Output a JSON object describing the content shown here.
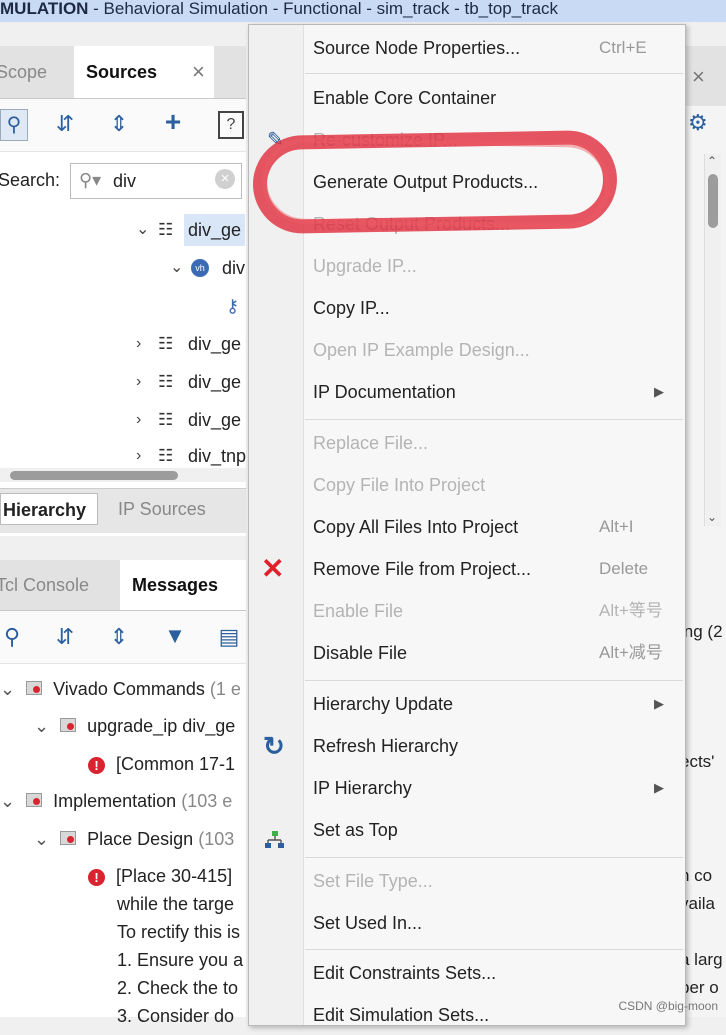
{
  "window": {
    "title_bold": "MULATION",
    "title_rest": " - Behavioral Simulation - Functional - sim_track - tb_top_track"
  },
  "sources_pane": {
    "tabs": [
      "Scope",
      "Sources"
    ],
    "close_glyph": "×",
    "search_label": "Search:",
    "search_value": "div",
    "tree": [
      {
        "label": "div_ge",
        "icon": "ip-core-icon",
        "expanded": true,
        "selected": true
      },
      {
        "label": "div",
        "icon": "vhdl-file-icon",
        "expanded": true
      },
      {
        "label": "",
        "icon": "key-icon"
      },
      {
        "label": "div_ge",
        "icon": "ip-core-icon"
      },
      {
        "label": "div_ge",
        "icon": "ip-core-icon"
      },
      {
        "label": "div_ge",
        "icon": "ip-core-icon"
      },
      {
        "label": "div_tnp",
        "icon": "ip-core-icon"
      }
    ],
    "bottom_tabs": [
      "Hierarchy",
      "IP Sources"
    ]
  },
  "messages_pane": {
    "tabs": [
      "Tcl Console",
      "Messages"
    ],
    "rows": [
      {
        "text": "Vivado Commands",
        "count": "(1 e"
      },
      {
        "text": "upgrade_ip div_ge",
        "count": ""
      },
      {
        "text": "[Common 17-1",
        "count": ""
      },
      {
        "text": "Implementation",
        "count": "(103 e"
      },
      {
        "text": "Place Design",
        "count": "(103"
      },
      {
        "text": "[Place 30-415]",
        "count": ""
      },
      {
        "text": "while the targe",
        "count": ""
      },
      {
        "text": "To rectify this is",
        "count": ""
      },
      {
        "text": "1. Ensure you a",
        "count": ""
      },
      {
        "text": "2. Check the to",
        "count": ""
      },
      {
        "text": "3. Consider do",
        "count": ""
      }
    ]
  },
  "right_fragments": [
    "ing (2",
    "ects'",
    "n co",
    "vaila",
    "a larg",
    "ber o"
  ],
  "context_menu": {
    "items": [
      {
        "label": "Source Node Properties...",
        "shortcut": "Ctrl+E",
        "enabled": true
      },
      {
        "label": "Enable Core Container",
        "enabled": true
      },
      {
        "label": "Re-customize IP...",
        "enabled": false
      },
      {
        "label": "Generate Output Products...",
        "enabled": true
      },
      {
        "label": "Reset Output Products...",
        "enabled": false
      },
      {
        "label": "Upgrade IP...",
        "enabled": false
      },
      {
        "label": "Copy IP...",
        "enabled": true
      },
      {
        "label": "Open IP Example Design...",
        "enabled": false
      },
      {
        "label": "IP Documentation",
        "enabled": true,
        "submenu": true
      },
      {
        "label": "Replace File...",
        "enabled": false
      },
      {
        "label": "Copy File Into Project",
        "enabled": false
      },
      {
        "label": "Copy All Files Into Project",
        "shortcut": "Alt+I",
        "enabled": true
      },
      {
        "label": "Remove File from Project...",
        "shortcut": "Delete",
        "enabled": true,
        "icon": "red-x-icon"
      },
      {
        "label": "Enable File",
        "shortcut": "Alt+等号",
        "enabled": false
      },
      {
        "label": "Disable File",
        "shortcut": "Alt+减号",
        "enabled": true
      },
      {
        "label": "Hierarchy Update",
        "enabled": true,
        "submenu": true
      },
      {
        "label": "Refresh Hierarchy",
        "enabled": true,
        "icon": "refresh-icon"
      },
      {
        "label": "IP Hierarchy",
        "enabled": true,
        "submenu": true
      },
      {
        "label": "Set as Top",
        "enabled": true,
        "icon": "hierarchy-tree-icon"
      },
      {
        "label": "Set File Type...",
        "enabled": false
      },
      {
        "label": "Set Used In...",
        "enabled": true
      },
      {
        "label": "Edit Constraints Sets...",
        "enabled": true
      },
      {
        "label": "Edit Simulation Sets...",
        "enabled": true
      }
    ],
    "annotation_color": "#e02837"
  },
  "watermark": "CSDN @big-moon"
}
